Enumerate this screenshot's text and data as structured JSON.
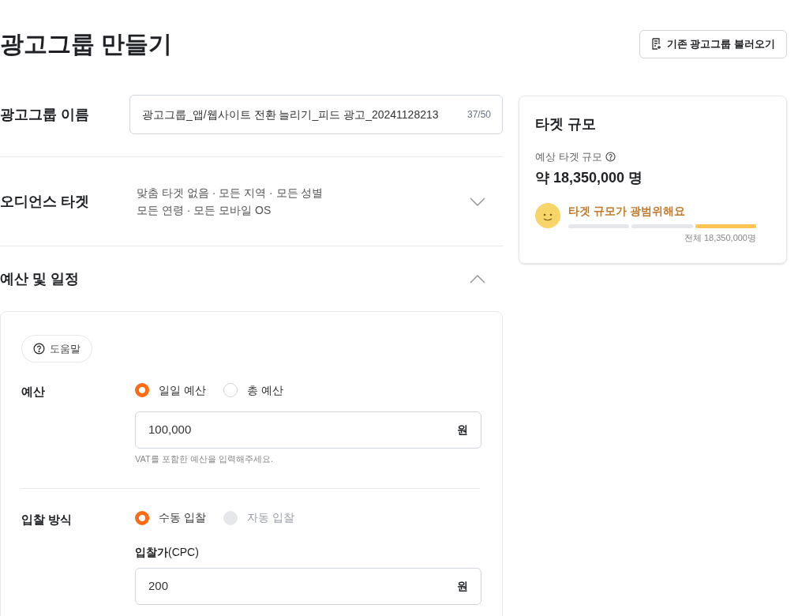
{
  "page_title": "광고그룹 만들기",
  "load_button": {
    "label": "기존 광고그룹 불러오기"
  },
  "name_row": {
    "label": "광고그룹 이름",
    "value": "광고그룹_앱/웹사이트 전환 늘리기_피드 광고_20241128213",
    "counter": "37/50"
  },
  "audience_row": {
    "label": "오디언스 타겟",
    "summary": [
      "맞춤 타겟 없음 · 모든 지역 · 모든 성별",
      "모든 연령 · 모든 모바일 OS"
    ],
    "expanded": false
  },
  "budget_section": {
    "label": "예산 및 일정",
    "expanded": true,
    "help_button": "도움말",
    "budget": {
      "label": "예산",
      "options": [
        {
          "label": "일일 예산",
          "selected": true,
          "disabled": false
        },
        {
          "label": "총 예산",
          "selected": false,
          "disabled": false
        }
      ],
      "value": "100,000",
      "unit": "원",
      "hint": "VAT를 포함한 예산을 입력해주세요."
    },
    "bidding": {
      "label": "입찰 방식",
      "options": [
        {
          "label": "수동 입찰",
          "selected": true,
          "disabled": false
        },
        {
          "label": "자동 입찰",
          "selected": false,
          "disabled": true
        }
      ],
      "field_label": "**입찰가**(CPC)",
      "value": "200",
      "unit": "원"
    }
  },
  "target_card": {
    "title": "타겟 규모",
    "estimate_label": "예상 타겟 규모",
    "estimate": "약 18,350,000 명",
    "status": "타겟 규모가 광범위해요",
    "segments": [
      {
        "on": false
      },
      {
        "on": false
      },
      {
        "on": true
      }
    ],
    "total": "전체 18,350,000명"
  }
}
